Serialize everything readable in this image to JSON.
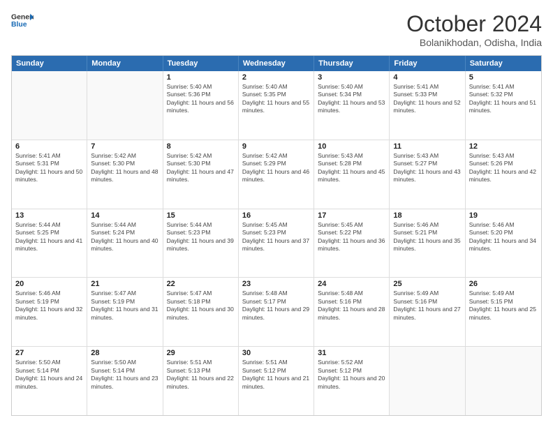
{
  "logo": {
    "line1": "General",
    "line2": "Blue"
  },
  "header": {
    "month": "October 2024",
    "location": "Bolanikhodan, Odisha, India"
  },
  "days": [
    "Sunday",
    "Monday",
    "Tuesday",
    "Wednesday",
    "Thursday",
    "Friday",
    "Saturday"
  ],
  "rows": [
    [
      {
        "day": "",
        "empty": true
      },
      {
        "day": "",
        "empty": true
      },
      {
        "day": "1",
        "sunrise": "Sunrise: 5:40 AM",
        "sunset": "Sunset: 5:36 PM",
        "daylight": "Daylight: 11 hours and 56 minutes."
      },
      {
        "day": "2",
        "sunrise": "Sunrise: 5:40 AM",
        "sunset": "Sunset: 5:35 PM",
        "daylight": "Daylight: 11 hours and 55 minutes."
      },
      {
        "day": "3",
        "sunrise": "Sunrise: 5:40 AM",
        "sunset": "Sunset: 5:34 PM",
        "daylight": "Daylight: 11 hours and 53 minutes."
      },
      {
        "day": "4",
        "sunrise": "Sunrise: 5:41 AM",
        "sunset": "Sunset: 5:33 PM",
        "daylight": "Daylight: 11 hours and 52 minutes."
      },
      {
        "day": "5",
        "sunrise": "Sunrise: 5:41 AM",
        "sunset": "Sunset: 5:32 PM",
        "daylight": "Daylight: 11 hours and 51 minutes."
      }
    ],
    [
      {
        "day": "6",
        "sunrise": "Sunrise: 5:41 AM",
        "sunset": "Sunset: 5:31 PM",
        "daylight": "Daylight: 11 hours and 50 minutes."
      },
      {
        "day": "7",
        "sunrise": "Sunrise: 5:42 AM",
        "sunset": "Sunset: 5:30 PM",
        "daylight": "Daylight: 11 hours and 48 minutes."
      },
      {
        "day": "8",
        "sunrise": "Sunrise: 5:42 AM",
        "sunset": "Sunset: 5:30 PM",
        "daylight": "Daylight: 11 hours and 47 minutes."
      },
      {
        "day": "9",
        "sunrise": "Sunrise: 5:42 AM",
        "sunset": "Sunset: 5:29 PM",
        "daylight": "Daylight: 11 hours and 46 minutes."
      },
      {
        "day": "10",
        "sunrise": "Sunrise: 5:43 AM",
        "sunset": "Sunset: 5:28 PM",
        "daylight": "Daylight: 11 hours and 45 minutes."
      },
      {
        "day": "11",
        "sunrise": "Sunrise: 5:43 AM",
        "sunset": "Sunset: 5:27 PM",
        "daylight": "Daylight: 11 hours and 43 minutes."
      },
      {
        "day": "12",
        "sunrise": "Sunrise: 5:43 AM",
        "sunset": "Sunset: 5:26 PM",
        "daylight": "Daylight: 11 hours and 42 minutes."
      }
    ],
    [
      {
        "day": "13",
        "sunrise": "Sunrise: 5:44 AM",
        "sunset": "Sunset: 5:25 PM",
        "daylight": "Daylight: 11 hours and 41 minutes."
      },
      {
        "day": "14",
        "sunrise": "Sunrise: 5:44 AM",
        "sunset": "Sunset: 5:24 PM",
        "daylight": "Daylight: 11 hours and 40 minutes."
      },
      {
        "day": "15",
        "sunrise": "Sunrise: 5:44 AM",
        "sunset": "Sunset: 5:23 PM",
        "daylight": "Daylight: 11 hours and 39 minutes."
      },
      {
        "day": "16",
        "sunrise": "Sunrise: 5:45 AM",
        "sunset": "Sunset: 5:23 PM",
        "daylight": "Daylight: 11 hours and 37 minutes."
      },
      {
        "day": "17",
        "sunrise": "Sunrise: 5:45 AM",
        "sunset": "Sunset: 5:22 PM",
        "daylight": "Daylight: 11 hours and 36 minutes."
      },
      {
        "day": "18",
        "sunrise": "Sunrise: 5:46 AM",
        "sunset": "Sunset: 5:21 PM",
        "daylight": "Daylight: 11 hours and 35 minutes."
      },
      {
        "day": "19",
        "sunrise": "Sunrise: 5:46 AM",
        "sunset": "Sunset: 5:20 PM",
        "daylight": "Daylight: 11 hours and 34 minutes."
      }
    ],
    [
      {
        "day": "20",
        "sunrise": "Sunrise: 5:46 AM",
        "sunset": "Sunset: 5:19 PM",
        "daylight": "Daylight: 11 hours and 32 minutes."
      },
      {
        "day": "21",
        "sunrise": "Sunrise: 5:47 AM",
        "sunset": "Sunset: 5:19 PM",
        "daylight": "Daylight: 11 hours and 31 minutes."
      },
      {
        "day": "22",
        "sunrise": "Sunrise: 5:47 AM",
        "sunset": "Sunset: 5:18 PM",
        "daylight": "Daylight: 11 hours and 30 minutes."
      },
      {
        "day": "23",
        "sunrise": "Sunrise: 5:48 AM",
        "sunset": "Sunset: 5:17 PM",
        "daylight": "Daylight: 11 hours and 29 minutes."
      },
      {
        "day": "24",
        "sunrise": "Sunrise: 5:48 AM",
        "sunset": "Sunset: 5:16 PM",
        "daylight": "Daylight: 11 hours and 28 minutes."
      },
      {
        "day": "25",
        "sunrise": "Sunrise: 5:49 AM",
        "sunset": "Sunset: 5:16 PM",
        "daylight": "Daylight: 11 hours and 27 minutes."
      },
      {
        "day": "26",
        "sunrise": "Sunrise: 5:49 AM",
        "sunset": "Sunset: 5:15 PM",
        "daylight": "Daylight: 11 hours and 25 minutes."
      }
    ],
    [
      {
        "day": "27",
        "sunrise": "Sunrise: 5:50 AM",
        "sunset": "Sunset: 5:14 PM",
        "daylight": "Daylight: 11 hours and 24 minutes."
      },
      {
        "day": "28",
        "sunrise": "Sunrise: 5:50 AM",
        "sunset": "Sunset: 5:14 PM",
        "daylight": "Daylight: 11 hours and 23 minutes."
      },
      {
        "day": "29",
        "sunrise": "Sunrise: 5:51 AM",
        "sunset": "Sunset: 5:13 PM",
        "daylight": "Daylight: 11 hours and 22 minutes."
      },
      {
        "day": "30",
        "sunrise": "Sunrise: 5:51 AM",
        "sunset": "Sunset: 5:12 PM",
        "daylight": "Daylight: 11 hours and 21 minutes."
      },
      {
        "day": "31",
        "sunrise": "Sunrise: 5:52 AM",
        "sunset": "Sunset: 5:12 PM",
        "daylight": "Daylight: 11 hours and 20 minutes."
      },
      {
        "day": "",
        "empty": true
      },
      {
        "day": "",
        "empty": true
      }
    ]
  ]
}
